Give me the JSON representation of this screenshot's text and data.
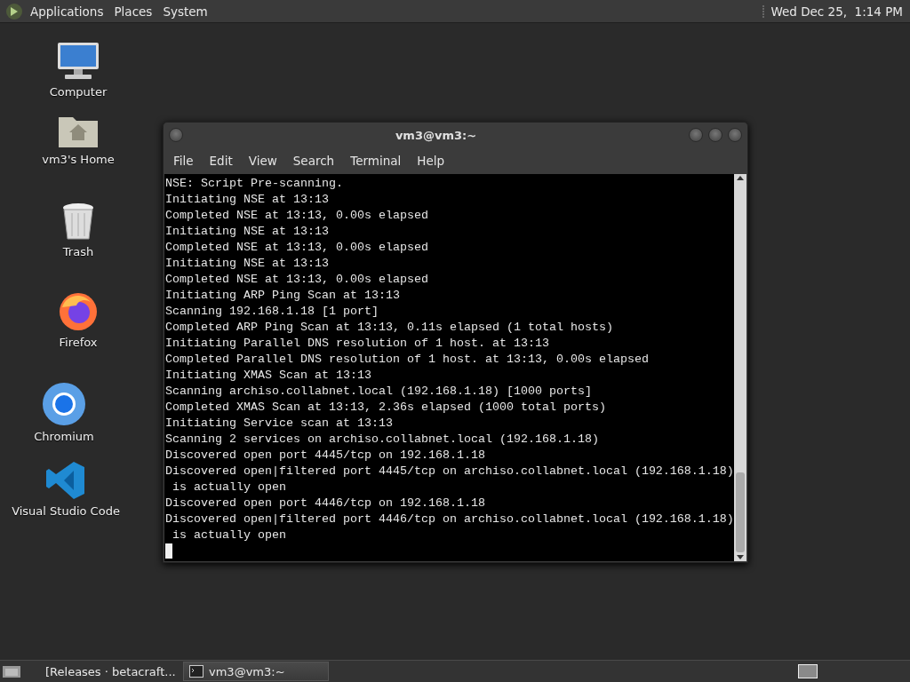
{
  "top_panel": {
    "menus": [
      "Applications",
      "Places",
      "System"
    ],
    "clock": "Wed Dec 25,  1:14 PM"
  },
  "desktop_icons": [
    {
      "kind": "computer",
      "label": "Computer"
    },
    {
      "kind": "home",
      "label": "vm3's Home"
    },
    {
      "kind": "trash",
      "label": "Trash"
    },
    {
      "kind": "firefox",
      "label": "Firefox"
    },
    {
      "kind": "chromium",
      "label": "Chromium"
    },
    {
      "kind": "vscode",
      "label": "Visual Studio Code"
    }
  ],
  "terminal": {
    "title": "vm3@vm3:~",
    "menu": [
      "File",
      "Edit",
      "View",
      "Search",
      "Terminal",
      "Help"
    ],
    "lines": [
      "NSE: Script Pre-scanning.",
      "Initiating NSE at 13:13",
      "Completed NSE at 13:13, 0.00s elapsed",
      "Initiating NSE at 13:13",
      "Completed NSE at 13:13, 0.00s elapsed",
      "Initiating NSE at 13:13",
      "Completed NSE at 13:13, 0.00s elapsed",
      "Initiating ARP Ping Scan at 13:13",
      "Scanning 192.168.1.18 [1 port]",
      "Completed ARP Ping Scan at 13:13, 0.11s elapsed (1 total hosts)",
      "Initiating Parallel DNS resolution of 1 host. at 13:13",
      "Completed Parallel DNS resolution of 1 host. at 13:13, 0.00s elapsed",
      "Initiating XMAS Scan at 13:13",
      "Scanning archiso.collabnet.local (192.168.1.18) [1000 ports]",
      "Completed XMAS Scan at 13:13, 2.36s elapsed (1000 total ports)",
      "Initiating Service scan at 13:13",
      "Scanning 2 services on archiso.collabnet.local (192.168.1.18)",
      "Discovered open port 4445/tcp on 192.168.1.18",
      "Discovered open|filtered port 4445/tcp on archiso.collabnet.local (192.168.1.18)",
      " is actually open",
      "Discovered open port 4446/tcp on 192.168.1.18",
      "Discovered open|filtered port 4446/tcp on archiso.collabnet.local (192.168.1.18)",
      " is actually open"
    ]
  },
  "taskbar": {
    "tasks": [
      {
        "kind": "firefox",
        "label": "[Releases · betacraft...",
        "selected": false
      },
      {
        "kind": "terminal",
        "label": "vm3@vm3:~",
        "selected": true
      }
    ]
  }
}
